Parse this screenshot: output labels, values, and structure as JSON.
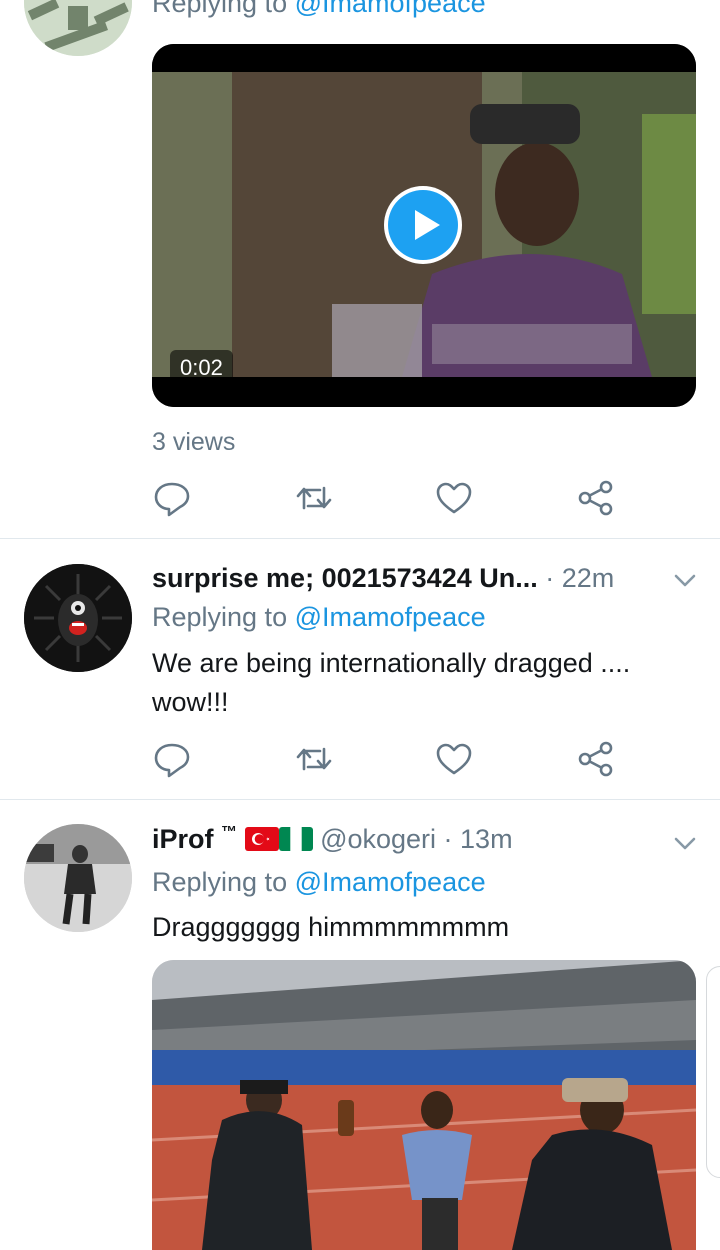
{
  "tweets": [
    {
      "replying_prefix": "Replying to",
      "replying_handle": "@Imamofpeace",
      "video_duration": "0:02",
      "views": "3 views"
    },
    {
      "name": "surprise me; 0021573424 Un...",
      "time": "· 22m",
      "replying_prefix": "Replying to",
      "replying_handle": "@Imamofpeace",
      "text_line1": "We are being internationally dragged ....",
      "text_line2": "wow!!!"
    },
    {
      "name": "iProf",
      "tm": "™",
      "handle": "@okogeri",
      "time": "· 13m",
      "replying_prefix": "Replying to",
      "replying_handle": "@Imamofpeace",
      "text": "Draggggggg himmmmmmmm"
    }
  ],
  "icons": [
    "reply-icon",
    "retweet-icon",
    "like-icon",
    "share-icon",
    "chevron-down-icon",
    "play-icon"
  ],
  "colors": {
    "link": "#1b95e0",
    "muted": "#657786",
    "divider": "#e1e8ed",
    "play": "#1da1f2"
  }
}
